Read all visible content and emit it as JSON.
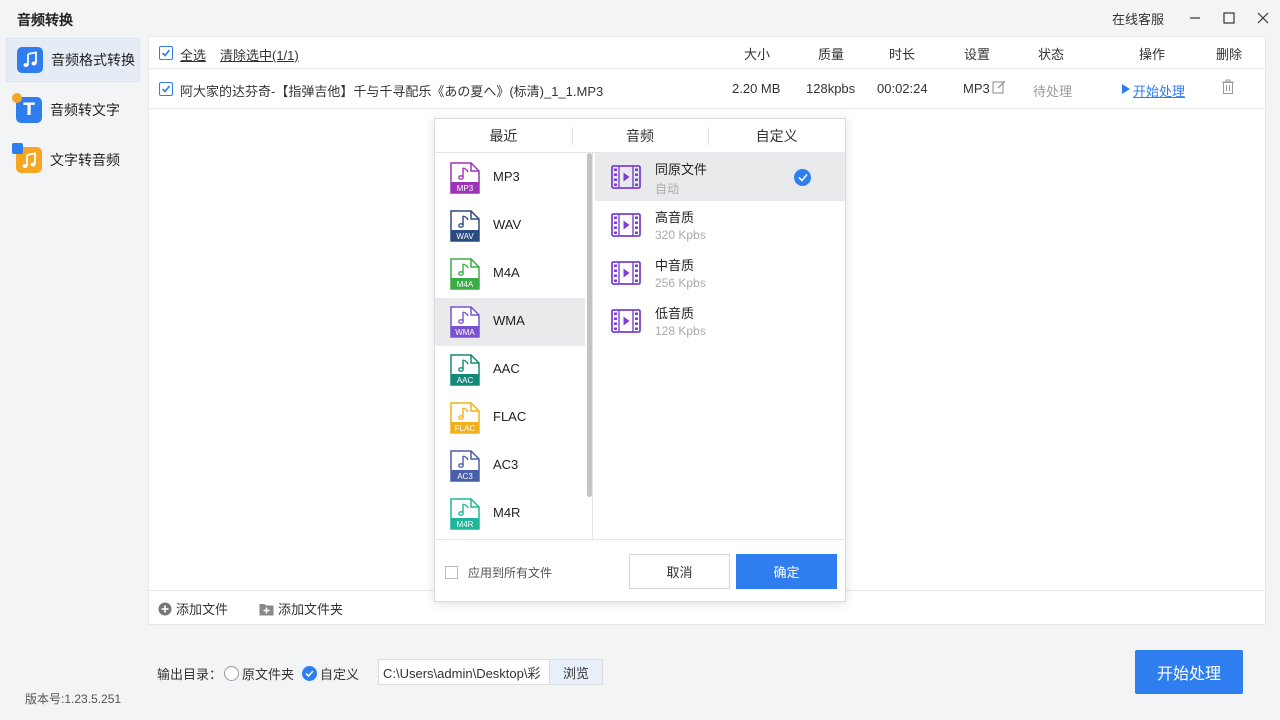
{
  "app": {
    "title": "音频转换",
    "service": "在线客服",
    "version": "版本号:1.23.5.251"
  },
  "sidebar": {
    "items": [
      {
        "label": "音频格式转换",
        "active": true
      },
      {
        "label": "音频转文字",
        "active": false
      },
      {
        "label": "文字转音频",
        "active": false
      }
    ]
  },
  "table": {
    "select_all": "全选",
    "clear_selected": "清除选中(1/1)",
    "columns": {
      "size": "大小",
      "quality": "质量",
      "duration": "时长",
      "settings": "设置",
      "status": "状态",
      "action": "操作",
      "delete": "删除"
    },
    "rows": [
      {
        "checked": true,
        "name": "阿大家的达芬奇-【指弹吉他】千与千寻配乐《あの夏へ》(标清)_1_1.MP3",
        "size": "2.20 MB",
        "quality": "128kpbs",
        "duration": "00:02:24",
        "format": "MP3",
        "status": "待处理",
        "action": "开始处理"
      }
    ]
  },
  "tools": {
    "add_file": "添加文件",
    "add_folder": "添加文件夹"
  },
  "output": {
    "label": "输出目录：",
    "option_original": "原文件夹",
    "option_custom": "自定义",
    "selected": "自定义",
    "path": "C:\\Users\\admin\\Desktop\\彩",
    "browse": "浏览"
  },
  "start_button": "开始处理",
  "dialog": {
    "tabs": [
      "最近",
      "音频",
      "自定义"
    ],
    "formats": [
      {
        "name": "MP3",
        "color": "#9b35b5",
        "icon": "mp3-file-icon"
      },
      {
        "name": "WAV",
        "color": "#2b4a7f",
        "icon": "wav-file-icon"
      },
      {
        "name": "M4A",
        "color": "#3aab45",
        "icon": "m4a-file-icon"
      },
      {
        "name": "WMA",
        "color": "#7a52d1",
        "icon": "wma-file-icon"
      },
      {
        "name": "AAC",
        "color": "#15887a",
        "icon": "aac-file-icon"
      },
      {
        "name": "FLAC",
        "color": "#f2b11a",
        "icon": "flac-file-icon"
      },
      {
        "name": "AC3",
        "color": "#4a5ea8",
        "icon": "ac3-file-icon"
      },
      {
        "name": "M4R",
        "color": "#1fb59a",
        "icon": "m4r-file-icon"
      }
    ],
    "selected_format": "WMA",
    "qualities": [
      {
        "name": "同原文件",
        "sub": "自动",
        "selected": true
      },
      {
        "name": "高音质",
        "sub": "320 Kpbs",
        "selected": false
      },
      {
        "name": "中音质",
        "sub": "256 Kpbs",
        "selected": false
      },
      {
        "name": "低音质",
        "sub": "128 Kpbs",
        "selected": false
      }
    ],
    "apply_all": "应用到所有文件",
    "cancel": "取消",
    "confirm": "确定"
  },
  "colors": {
    "accent": "#2f7ef0",
    "quality_icon": "#7b3fd6"
  }
}
